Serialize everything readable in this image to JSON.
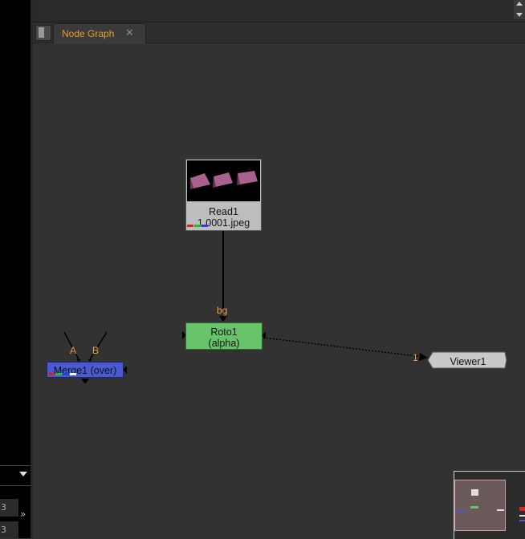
{
  "tab": {
    "label": "Node Graph",
    "close_glyph": "✕"
  },
  "nodes": {
    "read1": {
      "title": "Read1",
      "file": "1.0001.jpeg"
    },
    "roto1": {
      "title": "Roto1",
      "subtitle": "(alpha)",
      "input_label": "bg"
    },
    "merge1": {
      "title": "Merge1 (over)",
      "input_a": "A",
      "input_b": "B"
    },
    "viewer1": {
      "title": "Viewer1",
      "input_index": "1"
    }
  },
  "left_panel": {
    "value_1": "3",
    "value_2": "3",
    "chevron": "»"
  },
  "colors": {
    "roto": "#68c46b",
    "merge": "#4a5bd1",
    "viewer": "#c8c8c8",
    "read": "#bdbdbd",
    "accent": "#e89c2b"
  }
}
